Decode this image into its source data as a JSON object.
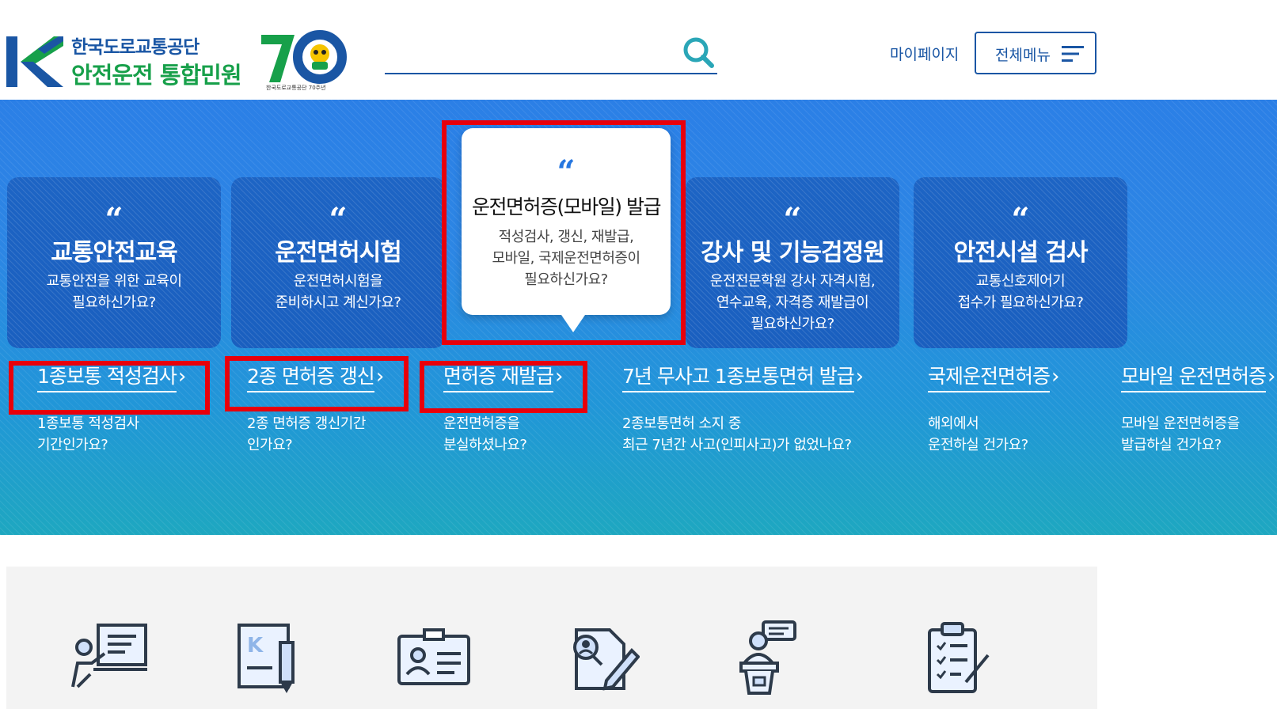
{
  "header": {
    "logo_line1": "한국도로교통공단",
    "logo_line2": "안전운전 통합민원",
    "anniversary_caption": "한국도로교통공단 70주년",
    "search_placeholder": "",
    "mypage_label": "마이페이지",
    "allmenu_label": "전체메뉴"
  },
  "cards": [
    {
      "title": "교통안전교육",
      "desc": "교통안전을 위한 교육이\n필요하신가요?"
    },
    {
      "title": "운전면허시험",
      "desc": "운전면허시험을\n준비하시고 계신가요?"
    },
    {
      "title": "운전면허증(모바일) 발급",
      "desc": "적성검사, 갱신, 재발급,\n모바일, 국제운전면허증이\n필요하신가요?"
    },
    {
      "title": "강사 및 기능검정원",
      "desc": "운전전문학원 강사 자격시험,\n연수교육, 자격증 재발급이\n필요하신가요?"
    },
    {
      "title": "안전시설 검사",
      "desc": "교통신호제어기\n접수가 필요하신가요?"
    }
  ],
  "quote_mark": "“",
  "sublinks": [
    {
      "title": "1종보통 적성검사",
      "desc": "1종보통 적성검사\n기간인가요?"
    },
    {
      "title": "2종 면허증 갱신",
      "desc": "2종 면허증 갱신기간\n인가요?"
    },
    {
      "title": "면허증 재발급",
      "desc": "운전면허증을\n분실하셨나요?"
    },
    {
      "title": "7년 무사고 1종보통면허 발급",
      "desc": "2종보통면허 소지 중\n최근 7년간 사고(인피사고)가 없었나요?"
    },
    {
      "title": "국제운전면허증",
      "desc": "해외에서\n운전하실 건가요?"
    },
    {
      "title": "모바일 운전면허증",
      "desc": "모바일 운전면허증을\n발급하실 건가요?"
    }
  ],
  "arrow_glyph": "›",
  "colors": {
    "brand_blue": "#1a56a4",
    "brand_green": "#17a04a",
    "hero_top": "#2b7fe6",
    "hero_bottom": "#1ea7c0",
    "highlight_red": "#e8000b",
    "card_bg": "#1d64c4"
  },
  "service_icons": [
    "presentation-icon",
    "document-pen-icon",
    "id-card-icon",
    "person-edit-icon",
    "speaker-podium-icon",
    "checklist-clipboard-icon"
  ]
}
